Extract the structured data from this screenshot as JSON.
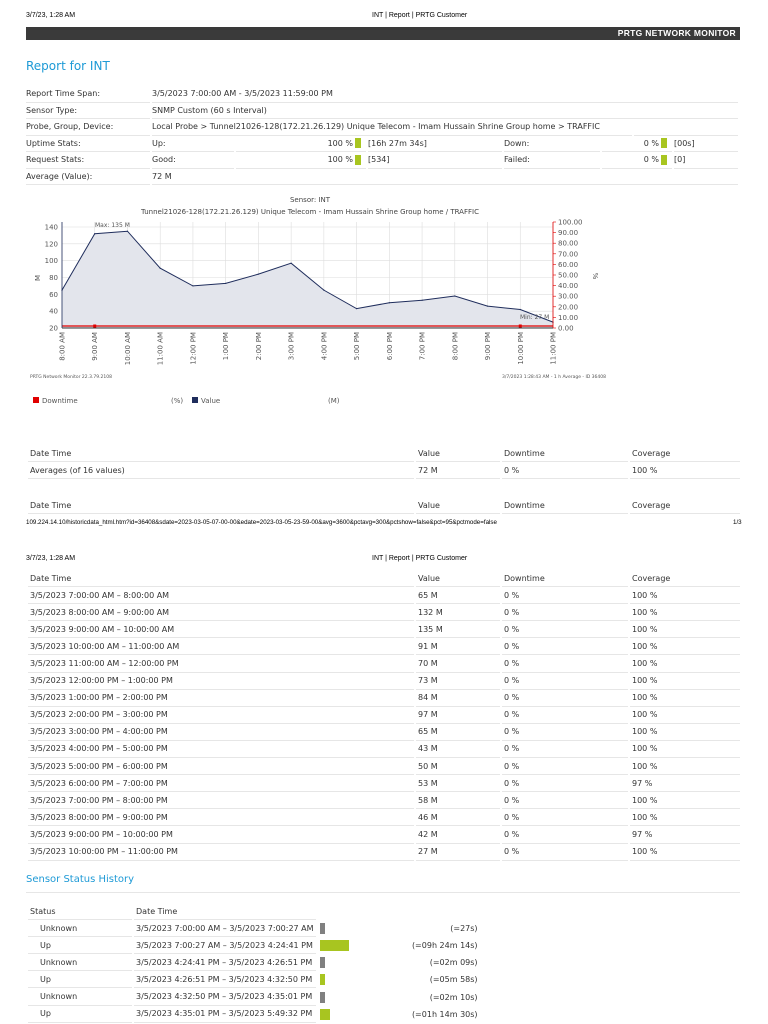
{
  "print_header": {
    "date": "3/7/23, 1:28 AM",
    "title": "INT | Report | PRTG Customer"
  },
  "brand": "PRTG NETWORK MONITOR",
  "report": {
    "title_prefix": "Report for",
    "title_name": "INT"
  },
  "info": {
    "time_span_label": "Report Time Span:",
    "time_span": "3/5/2023 7:00:00 AM - 3/5/2023 11:59:00 PM",
    "sensor_type_label": "Sensor Type:",
    "sensor_type": "SNMP Custom (60 s Interval)",
    "probe_label": "Probe, Group, Device:",
    "probe": "Local Probe > Tunnel21026-128(172.21.26.129) Unique Telecom - Imam Hussain Shrine Group home > TRAFFIC",
    "uptime_label": "Uptime Stats:",
    "up_label": "Up:",
    "up_pct": "100 %",
    "up_time": "[16h 27m 34s]",
    "down_label": "Down:",
    "down_pct": "0 %",
    "down_time": "[00s]",
    "request_label": "Request Stats:",
    "good_label": "Good:",
    "good_pct": "100 %",
    "good_count": "[534]",
    "failed_label": "Failed:",
    "failed_pct": "0 %",
    "failed_count": "[0]",
    "average_label": "Average (Value):",
    "average": "72 M"
  },
  "chart_data": {
    "type": "line",
    "title": "Sensor: INT",
    "subtitle": "Tunnel21026-128(172.21.26.129) Unique Telecom - Imam Hussain Shrine  Group home / TRAFFIC",
    "categories": [
      "8:00 AM",
      "9:00 AM",
      "10:00 AM",
      "11:00 AM",
      "12:00 PM",
      "1:00 PM",
      "2:00 PM",
      "3:00 PM",
      "4:00 PM",
      "5:00 PM",
      "6:00 PM",
      "7:00 PM",
      "8:00 PM",
      "9:00 PM",
      "10:00 PM",
      "11:00 PM"
    ],
    "series": [
      {
        "name": "Value",
        "unit": "(M)",
        "color": "#1f2d5c",
        "values": [
          65,
          132,
          135,
          91,
          70,
          73,
          84,
          97,
          65,
          43,
          50,
          53,
          58,
          46,
          42,
          27
        ]
      },
      {
        "name": "Downtime",
        "unit": "(%)",
        "color": "#e00000",
        "values": [
          0,
          0,
          0,
          0,
          0,
          0,
          0,
          0,
          0,
          0,
          0,
          0,
          0,
          0,
          0,
          0
        ]
      }
    ],
    "ylabel": "M",
    "y2label": "%",
    "ylim": [
      20,
      140
    ],
    "yticks": [
      "20",
      "40",
      "60",
      "80",
      "100",
      "120",
      "140"
    ],
    "y2lim": [
      0,
      100
    ],
    "y2ticks": [
      "0.00",
      "10.00",
      "20.00",
      "30.00",
      "40.00",
      "50.00",
      "60.00",
      "70.00",
      "80.00",
      "90.00",
      "100.00"
    ],
    "max_label": "Max: 135 M",
    "min_label": "Min: 27 M",
    "footer_left": "PRTG Network Monitor 22.3.79.2108",
    "footer_right": "3/7/2023 1:28:43 AM - 1 h Average - ID 36408"
  },
  "summary_table": {
    "headers": [
      "Date Time",
      "Value",
      "Downtime",
      "Coverage"
    ],
    "row": [
      "Averages (of 16 values)",
      "72 M",
      "0 %",
      "100 %"
    ]
  },
  "url_footer": {
    "url": "109.224.14.10/historicdata_html.htm?id=36408&sdate=2023-03-05-07-00-00&edate=2023-03-05-23-59-00&avg=3600&pctavg=300&pctshow=false&pct=95&pctmode=false",
    "page": "1/3"
  },
  "data_table": {
    "headers": [
      "Date Time",
      "Value",
      "Downtime",
      "Coverage"
    ],
    "rows": [
      [
        "3/5/2023 7:00:00 AM – 8:00:00 AM",
        "65 M",
        "0 %",
        "100 %"
      ],
      [
        "3/5/2023 8:00:00 AM – 9:00:00 AM",
        "132 M",
        "0 %",
        "100 %"
      ],
      [
        "3/5/2023 9:00:00 AM – 10:00:00 AM",
        "135 M",
        "0 %",
        "100 %"
      ],
      [
        "3/5/2023 10:00:00 AM – 11:00:00 AM",
        "91 M",
        "0 %",
        "100 %"
      ],
      [
        "3/5/2023 11:00:00 AM – 12:00:00 PM",
        "70 M",
        "0 %",
        "100 %"
      ],
      [
        "3/5/2023 12:00:00 PM – 1:00:00 PM",
        "73 M",
        "0 %",
        "100 %"
      ],
      [
        "3/5/2023 1:00:00 PM – 2:00:00 PM",
        "84 M",
        "0 %",
        "100 %"
      ],
      [
        "3/5/2023 2:00:00 PM – 3:00:00 PM",
        "97 M",
        "0 %",
        "100 %"
      ],
      [
        "3/5/2023 3:00:00 PM – 4:00:00 PM",
        "65 M",
        "0 %",
        "100 %"
      ],
      [
        "3/5/2023 4:00:00 PM – 5:00:00 PM",
        "43 M",
        "0 %",
        "100 %"
      ],
      [
        "3/5/2023 5:00:00 PM – 6:00:00 PM",
        "50 M",
        "0 %",
        "100 %"
      ],
      [
        "3/5/2023 6:00:00 PM – 7:00:00 PM",
        "53 M",
        "0 %",
        "97 %"
      ],
      [
        "3/5/2023 7:00:00 PM – 8:00:00 PM",
        "58 M",
        "0 %",
        "100 %"
      ],
      [
        "3/5/2023 8:00:00 PM – 9:00:00 PM",
        "46 M",
        "0 %",
        "100 %"
      ],
      [
        "3/5/2023 9:00:00 PM – 10:00:00 PM",
        "42 M",
        "0 %",
        "97 %"
      ],
      [
        "3/5/2023 10:00:00 PM – 11:00:00 PM",
        "27 M",
        "0 %",
        "100 %"
      ]
    ]
  },
  "status_history": {
    "title": "Sensor Status History",
    "headers": [
      "Status",
      "Date Time"
    ],
    "colors": {
      "Up": "#a8c520",
      "Unknown": "#808080"
    },
    "rows": [
      {
        "status": "Unknown",
        "range": "3/5/2023 7:00:00 AM – 3/5/2023 7:00:27 AM",
        "duration": "(=27s)",
        "share": 0.01
      },
      {
        "status": "Up",
        "range": "3/5/2023 7:00:27 AM – 3/5/2023 4:24:41 PM",
        "duration": "(=09h 24m 14s)",
        "share": 0.57
      },
      {
        "status": "Unknown",
        "range": "3/5/2023 4:24:41 PM – 3/5/2023 4:26:51 PM",
        "duration": "(=02m 09s)",
        "share": 0.01
      },
      {
        "status": "Up",
        "range": "3/5/2023 4:26:51 PM – 3/5/2023 4:32:50 PM",
        "duration": "(=05m 58s)",
        "share": 0.02
      },
      {
        "status": "Unknown",
        "range": "3/5/2023 4:32:50 PM – 3/5/2023 4:35:01 PM",
        "duration": "(=02m 10s)",
        "share": 0.01
      },
      {
        "status": "Up",
        "range": "3/5/2023 4:35:01 PM – 3/5/2023 5:49:32 PM",
        "duration": "(=01h 14m 30s)",
        "share": 0.2
      }
    ]
  }
}
